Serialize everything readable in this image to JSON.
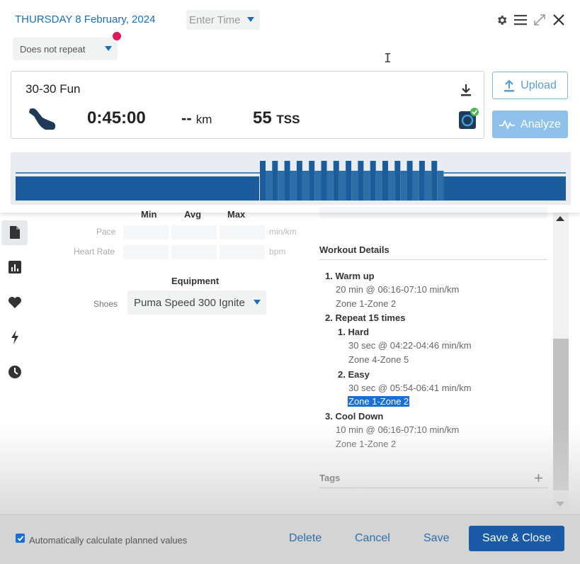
{
  "header": {
    "date": "THURSDAY 8 February, 2024",
    "time_placeholder": "Enter Time",
    "repeat_value": "Does not repeat"
  },
  "workout": {
    "title": "30-30 Fun",
    "duration": "0:45:00",
    "distance_value": "--",
    "distance_unit": "km",
    "tss_value": "55",
    "tss_unit": "TSS"
  },
  "actions": {
    "upload": "Upload",
    "analyze": "Analyze"
  },
  "metrics": {
    "col_min": "Min",
    "col_avg": "Avg",
    "col_max": "Max",
    "pace_label": "Pace",
    "pace_unit": "min/km",
    "hr_label": "Heart Rate",
    "hr_unit": "bpm"
  },
  "equipment": {
    "title": "Equipment",
    "shoes_label": "Shoes",
    "shoes_value": "Puma Speed 300 Ignite"
  },
  "details": {
    "title": "Workout Details",
    "steps": [
      {
        "title": "1. Warm up",
        "lines": [
          "20 min @ 06:16-07:10 min/km",
          "Zone 1-Zone 2"
        ]
      },
      {
        "title": "2. Repeat 15 times"
      },
      {
        "title": "1. Hard",
        "lines": [
          "30 sec @ 04:22-04:46 min/km",
          "Zone 4-Zone 5"
        ]
      },
      {
        "title": "2. Easy",
        "lines": [
          "30 sec @ 05:54-06:41 min/km",
          "Zone 1-Zone 2"
        ]
      },
      {
        "title": "3. Cool Down",
        "lines": [
          "10 min @ 06:16-07:10 min/km",
          "Zone 1-Zone 2"
        ]
      }
    ],
    "tags": "Tags"
  },
  "footer": {
    "auto_calc": "Automatically calculate planned values",
    "delete": "Delete",
    "cancel": "Cancel",
    "save": "Save",
    "save_close": "Save & Close"
  },
  "colors": {
    "accent": "#1a6fb5",
    "bar": "#1b5d9c",
    "analyze": "#8fc1ea",
    "save_close": "#1a5aa6",
    "badge": "#e0175b"
  },
  "icons": [
    "gear-icon",
    "menu-icon",
    "expand-icon",
    "close-icon",
    "shoe-icon",
    "download-icon",
    "device-sync-icon",
    "upload-icon",
    "pulse-icon",
    "document-icon",
    "bar-chart-icon",
    "heart-icon",
    "lightning-icon",
    "clock-icon",
    "plus-icon"
  ]
}
